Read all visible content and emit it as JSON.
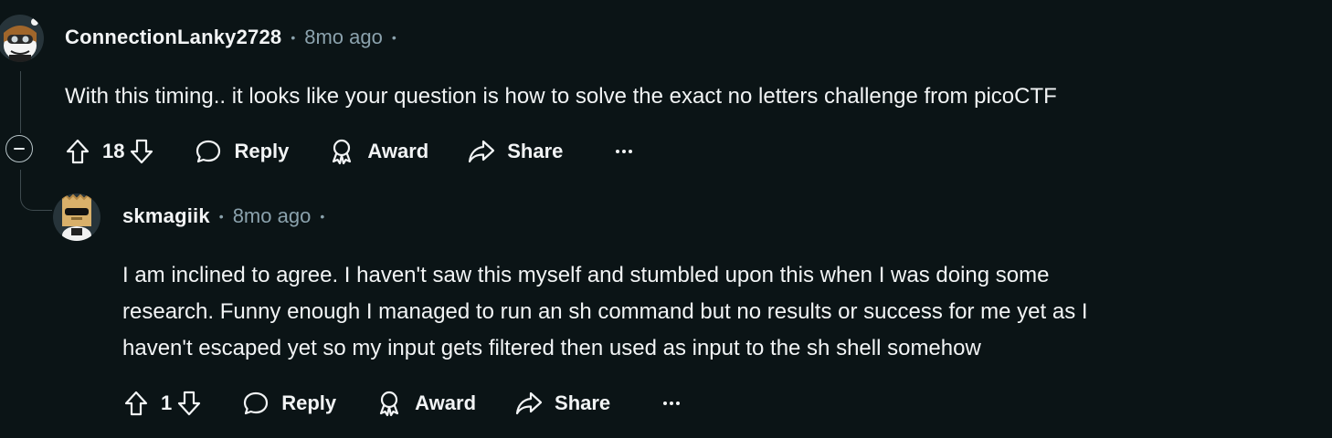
{
  "comments": [
    {
      "username": "ConnectionLanky2728",
      "separator": "•",
      "time": "8mo ago",
      "trailing_separator": "•",
      "body_lines": [
        "With this timing.. it looks like your question is how to solve the exact no letters challenge from picoCTF"
      ],
      "votes": "18",
      "actions": {
        "reply": "Reply",
        "award": "Award",
        "share": "Share"
      },
      "avatar_icon": "snoo-avatar-goggles-icon"
    },
    {
      "username": "skmagiik",
      "separator": "•",
      "time": "8mo ago",
      "trailing_separator": "•",
      "body_lines": [
        "I am inclined to agree. I haven't saw this myself and stumbled upon this when I was doing some",
        "research. Funny enough I managed to run an sh command but no results or success for me yet as I",
        "haven't escaped yet so my input gets filtered then used as input to the sh shell somehow"
      ],
      "votes": "1",
      "actions": {
        "reply": "Reply",
        "award": "Award",
        "share": "Share"
      },
      "avatar_icon": "snoo-avatar-box-head-icon"
    }
  ],
  "colors": {
    "background": "#0b1416",
    "text": "#f2f4f5",
    "meta": "#8ba2ad",
    "thread_line": "#3e4a4e"
  }
}
